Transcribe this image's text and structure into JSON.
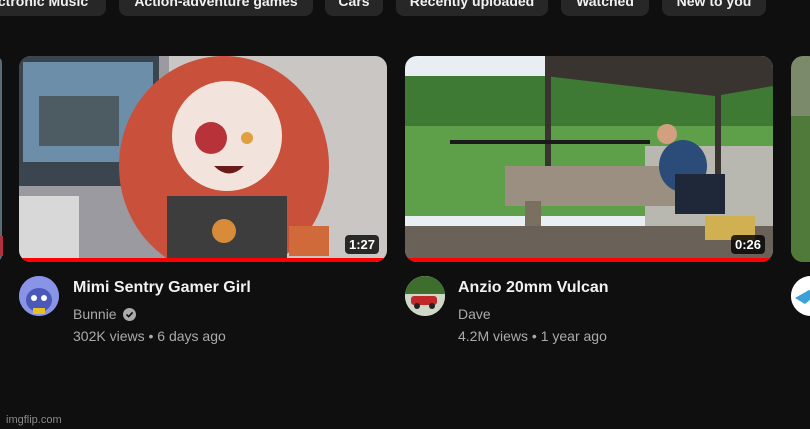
{
  "chips": [
    {
      "label": "ctronic Music"
    },
    {
      "label": "Action-adventure games"
    },
    {
      "label": "Cars"
    },
    {
      "label": "Recently uploaded"
    },
    {
      "label": "Watched"
    },
    {
      "label": "New to you"
    }
  ],
  "videos": [
    {
      "title": "Mimi Sentry Gamer Girl",
      "channel": "Bunnie",
      "verified": true,
      "views": "302K views",
      "age": "6 days ago",
      "separator": "•",
      "duration": "1:27",
      "watched_progress": 1.0,
      "thumbnail_icon": "anime-character-thumbnail",
      "avatar_icon": "blue-fox-avatar"
    },
    {
      "title": "Anzio 20mm Vulcan",
      "channel": "Dave",
      "verified": false,
      "views": "4.2M views",
      "age": "1 year ago",
      "separator": "•",
      "duration": "0:26",
      "watched_progress": 1.0,
      "thumbnail_icon": "shooting-range-thumbnail",
      "avatar_icon": "red-car-avatar"
    }
  ],
  "watermark": "imgflip.com",
  "colors": {
    "background": "#0f0f0f",
    "chip_bg": "#272727",
    "progress": "#ff0000",
    "secondary_text": "#aaaaaa"
  }
}
